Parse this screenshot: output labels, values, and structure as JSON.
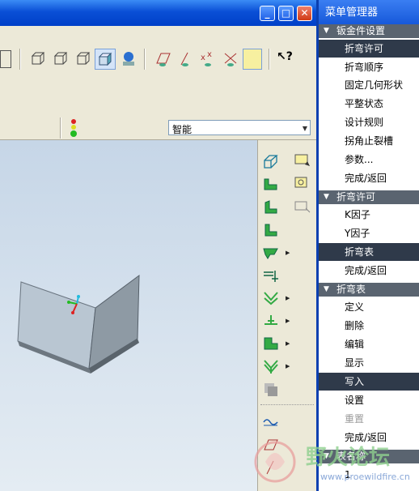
{
  "menu_manager": {
    "title": "菜单管理器",
    "sections": [
      {
        "header": "钣金件设置",
        "items": [
          {
            "label": "折弯许可",
            "selected": true
          },
          {
            "label": "折弯顺序"
          },
          {
            "label": "固定几何形状"
          },
          {
            "label": "平整状态"
          },
          {
            "label": "设计规则"
          },
          {
            "label": "拐角止裂槽"
          },
          {
            "label": "参数..."
          },
          {
            "label": "完成/返回"
          }
        ]
      },
      {
        "header": "折弯许可",
        "items": [
          {
            "label": "K因子"
          },
          {
            "label": "Y因子"
          },
          {
            "label": "折弯表",
            "selected": true
          },
          {
            "label": "完成/返回"
          }
        ]
      },
      {
        "header": "折弯表",
        "items": [
          {
            "label": "定义"
          },
          {
            "label": "删除"
          },
          {
            "label": "编辑"
          },
          {
            "label": "显示"
          },
          {
            "label": "写入",
            "selected": true
          },
          {
            "label": "设置"
          },
          {
            "label": "重置",
            "disabled": true
          },
          {
            "label": "完成/返回"
          }
        ]
      },
      {
        "header": "表名称",
        "items": [
          {
            "label": "1"
          }
        ]
      }
    ]
  },
  "filter": {
    "value": "智能"
  },
  "watermark": {
    "text": "野火论坛",
    "url": "www.proewildfire.cn"
  },
  "colors": {
    "panel_header": "#5a6470",
    "selected": "#2f3a4a",
    "title": "#1456d8"
  }
}
